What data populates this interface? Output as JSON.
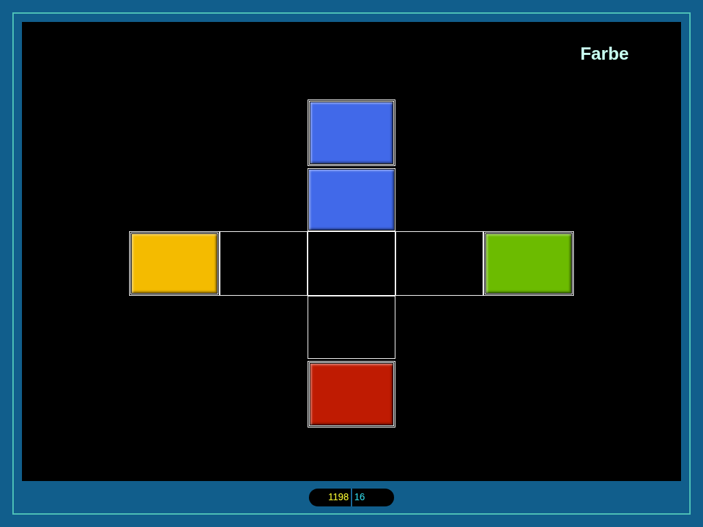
{
  "title": "Farbe",
  "targets": {
    "top": {
      "color": "#4169e9"
    },
    "left": {
      "color": "#f4bb00"
    },
    "right": {
      "color": "#6cbb00"
    },
    "bottom": {
      "color": "#bf1b02"
    }
  },
  "slots": {
    "top": {
      "filled": true,
      "color": "#4169e9"
    },
    "left": {
      "filled": false
    },
    "center": {
      "filled": false
    },
    "right": {
      "filled": false
    },
    "bottom": {
      "filled": false
    }
  },
  "counter": {
    "score": "1198",
    "moves": "16"
  }
}
